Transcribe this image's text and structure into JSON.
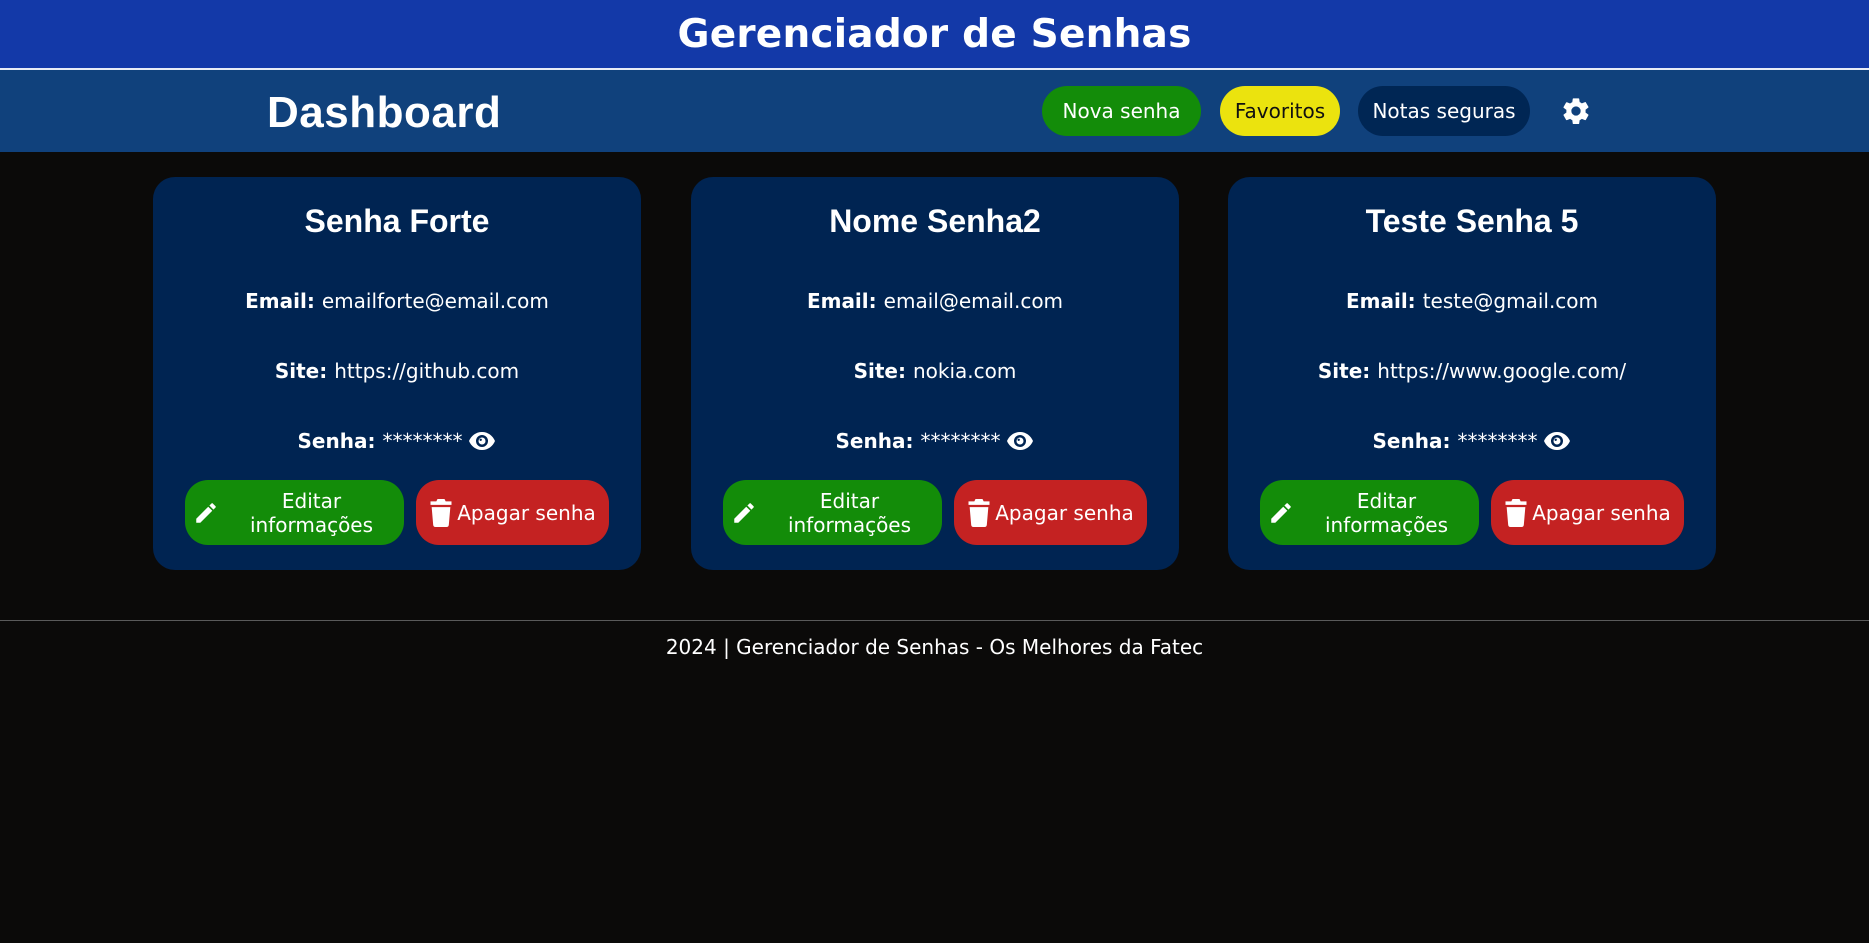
{
  "header": {
    "title": "Gerenciador de Senhas"
  },
  "nav": {
    "page_title": "Dashboard",
    "nova_senha": "Nova senha",
    "favoritos": "Favoritos",
    "notas_seguras": "Notas seguras",
    "settings_icon": "gear-icon"
  },
  "colors": {
    "header_bg": "#1339a8",
    "nav_bg": "#10417c",
    "card_bg": "#002452",
    "green": "#138c09",
    "yellow": "#ebe30e",
    "red": "#c42222",
    "page_bg": "#0b0a09"
  },
  "labels": {
    "email": "Email:",
    "site": "Site:",
    "senha": "Senha:",
    "edit": "Editar informações",
    "delete": "Apagar senha"
  },
  "cards": [
    {
      "title": "Senha Forte",
      "email": "emailforte@email.com",
      "site": "https://github.com",
      "senha": "********"
    },
    {
      "title": "Nome Senha2",
      "email": "email@email.com",
      "site": "nokia.com",
      "senha": "********"
    },
    {
      "title": "Teste Senha 5",
      "email": "teste@gmail.com",
      "site": "https://www.google.com/",
      "senha": "********"
    }
  ],
  "footer": {
    "text": "2024 | Gerenciador de Senhas - Os Melhores da Fatec"
  }
}
